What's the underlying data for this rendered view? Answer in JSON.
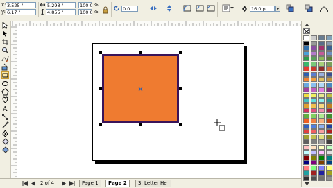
{
  "property_bar": {
    "x_value": "3.525 \"",
    "y_value": "6.17 \"",
    "width_value": "5.298 \"",
    "height_value": "4.855 \"",
    "scale_x": "100.0",
    "scale_y": "100.0",
    "percent_symbol": "%",
    "rotation_value": "0.0",
    "outline_width": "16.0 pt"
  },
  "document": {
    "page_counter": "2 of 4",
    "tabs": [
      {
        "label": "Page 1"
      },
      {
        "label": "Page 2"
      },
      {
        "label": "3: Letter He"
      }
    ]
  },
  "colors": {
    "fill": "#ef7b30",
    "outline": "#3a1459",
    "palette": [
      [
        "#ffffff",
        "#cccccc",
        "#6a7d91",
        "#80a0b8"
      ],
      [
        "#000000",
        "#999999",
        "#5a6e8a",
        "#889ab0"
      ],
      [
        "#2f6fa8",
        "#8b4ea3",
        "#a3326e",
        "#3a5f8e"
      ],
      [
        "#4aa0d8",
        "#b47acb",
        "#c45a9a",
        "#6e8fc0"
      ],
      [
        "#2c9a4a",
        "#5aa05a",
        "#8ab85a",
        "#5a7f3a"
      ],
      [
        "#3ab86a",
        "#7ac87a",
        "#a8d07a",
        "#7a9f5a"
      ],
      [
        "#e63b2e",
        "#c8392d",
        "#8e2d2a",
        "#d46a3a"
      ],
      [
        "#2e5fb0",
        "#5a7fcf",
        "#9ab0df",
        "#3a4f90"
      ],
      [
        "#f08030",
        "#f0a040",
        "#e0c060",
        "#c09040"
      ],
      [
        "#6aa8e0",
        "#8ac0f0",
        "#b0d8f8",
        "#4a88c0"
      ],
      [
        "#a040a0",
        "#c060c0",
        "#e080e0",
        "#803080"
      ],
      [
        "#f0e040",
        "#f0f060",
        "#e8e890",
        "#c0c040"
      ],
      [
        "#40c0c0",
        "#60e0e0",
        "#90f0f0",
        "#309090"
      ],
      [
        "#e0a030",
        "#f0c050",
        "#f8d880",
        "#c08020"
      ],
      [
        "#d03060",
        "#e05080",
        "#f090b0",
        "#a02040"
      ],
      [
        "#60b040",
        "#80d060",
        "#b0e890",
        "#409030"
      ],
      [
        "#f06020",
        "#f08040",
        "#f8b080",
        "#c04010"
      ],
      [
        "#3060c0",
        "#5080e0",
        "#90b0f0",
        "#2040a0"
      ],
      [
        "#e04040",
        "#f06060",
        "#f8a0a0",
        "#b02020"
      ],
      [
        "#a0a030",
        "#c0c050",
        "#e0e080",
        "#808020"
      ],
      [
        "#606060",
        "#808080",
        "#a0a0a0",
        "#404040"
      ],
      [
        "#ffc0c0",
        "#ffe0c0",
        "#ffffc0",
        "#c0ffc0"
      ],
      [
        "#c0ffff",
        "#c0c0ff",
        "#ffc0ff",
        "#e0e0e0"
      ],
      [
        "#800000",
        "#808000",
        "#008000",
        "#008080"
      ],
      [
        "#000080",
        "#800080",
        "#804000",
        "#004080"
      ],
      [
        "#ff8080",
        "#80ff80",
        "#8080ff",
        "#ffff80"
      ],
      [
        "#20a0a0",
        "#a02020",
        "#2020a0",
        "#a0a020"
      ],
      [
        "#303030",
        "#505050",
        "#707070",
        "#909090"
      ]
    ]
  }
}
